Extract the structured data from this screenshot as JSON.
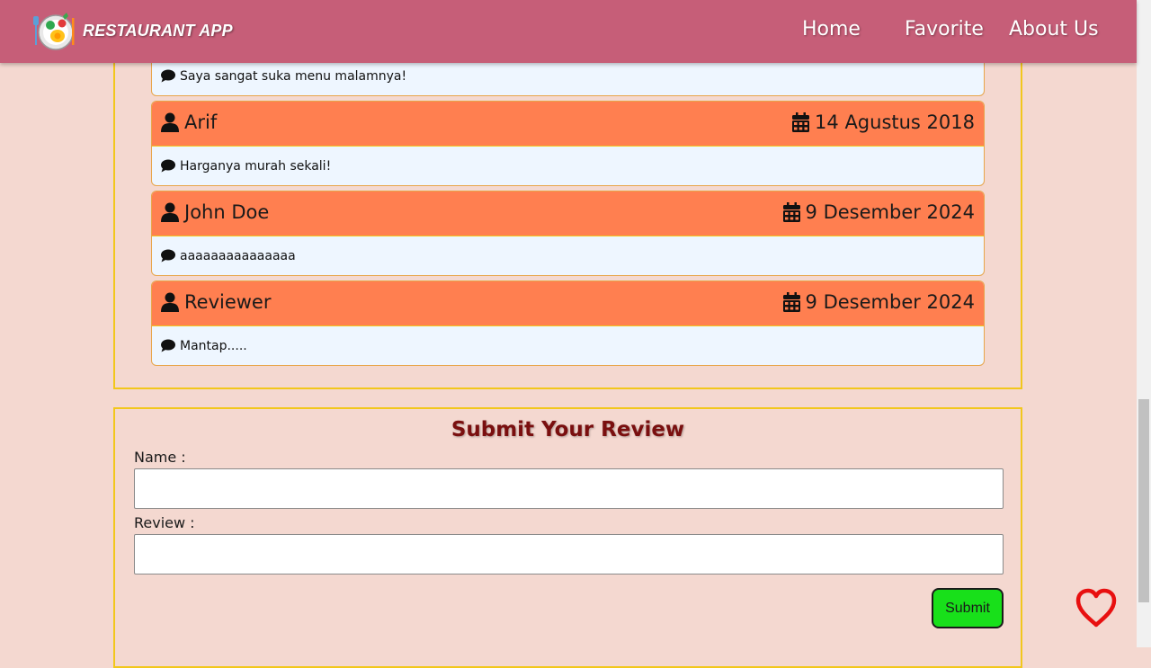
{
  "header": {
    "brand": "RESTAURANT APP",
    "nav": [
      {
        "label": "Home"
      },
      {
        "label": "Favorite"
      },
      {
        "label": "About Us"
      }
    ]
  },
  "reviews": [
    {
      "name": "",
      "date": "",
      "text": "Saya sangat suka menu malamnya!"
    },
    {
      "name": "Arif",
      "date": "14 Agustus 2018",
      "text": "Harganya murah sekali!"
    },
    {
      "name": "John Doe",
      "date": "9 Desember 2024",
      "text": "aaaaaaaaaaaaaaa"
    },
    {
      "name": "Reviewer",
      "date": "9 Desember 2024",
      "text": "Mantap....."
    }
  ],
  "form": {
    "title": "Submit Your Review",
    "name_label": "Name :",
    "review_label": "Review :",
    "name_value": "",
    "review_value": "",
    "submit_label": "Submit"
  },
  "icons": {
    "user": "user-icon",
    "calendar": "calendar-icon",
    "comment": "comment-icon",
    "favorite": "heart-icon",
    "logo": "restaurant-logo-icon"
  },
  "colors": {
    "navbar": "#c65e78",
    "page_background": "#f4d8d0",
    "review_header": "#ff7f50",
    "review_body": "#eef6ff",
    "section_border": "#f2c71c",
    "form_title": "#7a0f0f",
    "submit_button": "#18e01a",
    "heart": "#e81010"
  }
}
